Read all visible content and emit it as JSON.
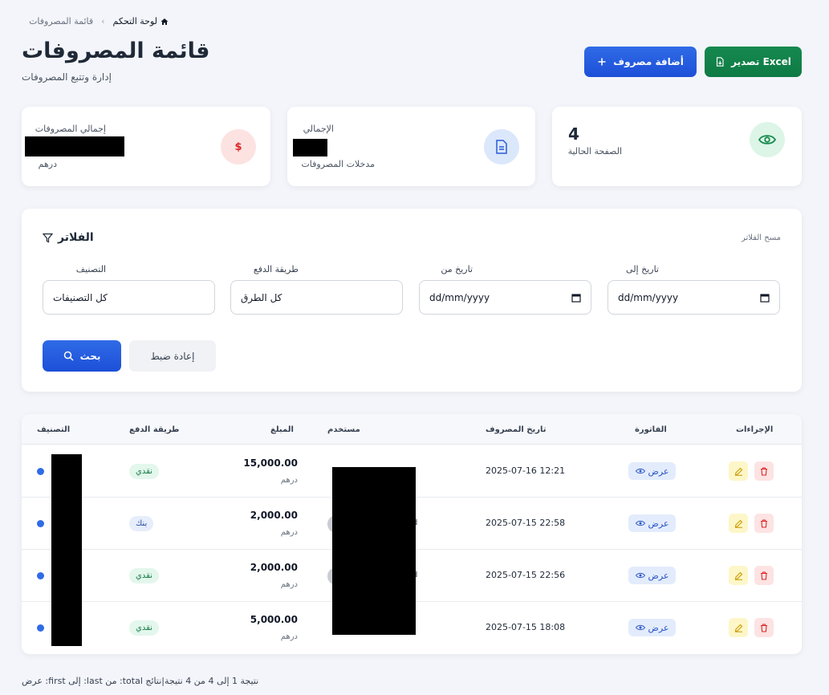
{
  "breadcrumb": {
    "home": "لوحة التحكم",
    "current": "قائمة المصروفات"
  },
  "header": {
    "title": "قائمة المصروفات",
    "subtitle": "إدارة وتتبع المصروفات"
  },
  "actions": {
    "export_label": "Excel تصدير",
    "add_label": "أضافة مصروف"
  },
  "stats": {
    "total": {
      "label": "إجمالي المصروفات",
      "unit": "درهم"
    },
    "entries": {
      "label": "الإجمالي",
      "sub": "مدخلات المصروفات"
    },
    "page": {
      "value": "4",
      "label": "الصفحة الحالية"
    }
  },
  "filter": {
    "title": "الفلاتر",
    "clear": "مسح الفلاتر",
    "category_label": "التصنيف",
    "category_value": "كل التصنيفات",
    "payment_label": "طريقة الدفع",
    "payment_value": "كل الطرق",
    "date_from_label": "تاريخ من",
    "date_from_placeholder": "dd/mm/yyyy",
    "date_to_label": "تاريخ إلى",
    "date_to_placeholder": "dd/mm/yyyy",
    "reset_label": "إعادة ضبط",
    "search_label": "بحث"
  },
  "table": {
    "columns": {
      "category": "التصنيف",
      "payment": "طريقة الدفع",
      "amount": "المبلغ",
      "user": "مستخدم",
      "date": "تاريخ المصروف",
      "invoice": "الفاتورة",
      "actions": "الإجراءات"
    },
    "rows": [
      {
        "payment": "نقدي",
        "payment_type": "cash",
        "amount": "15,000.00",
        "currency": "درهم",
        "user_tail": "",
        "date": "2025-07-16 12:21",
        "view": "عرض"
      },
      {
        "payment": "بنك",
        "payment_type": "bank",
        "amount": "2,000.00",
        "currency": "درهم",
        "user_tail": "d",
        "date": "2025-07-15 22:58",
        "view": "عرض"
      },
      {
        "payment": "نقدي",
        "payment_type": "cash",
        "amount": "2,000.00",
        "currency": "درهم",
        "user_tail": "d",
        "date": "2025-07-15 22:56",
        "view": "عرض"
      },
      {
        "payment": "نقدي",
        "payment_type": "cash",
        "amount": "5,000.00",
        "currency": "درهم",
        "user_tail": "",
        "date": "2025-07-15 18:08",
        "view": "عرض"
      }
    ]
  },
  "footer": {
    "summary": "نتيجة 1 إلى 4 من 4 نتيجة|نتائج total: من last: إلى first: عرض"
  },
  "colors": {
    "primary": "#1d4fd8",
    "success": "#0f7a44",
    "danger": "#dc2626",
    "warning": "#d4a106"
  }
}
